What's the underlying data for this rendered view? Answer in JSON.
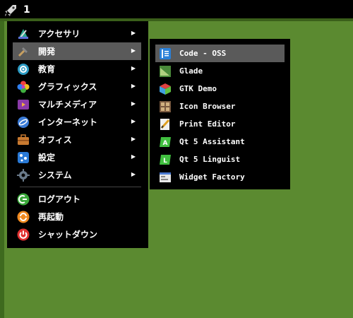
{
  "panel": {
    "workspace_number": "1",
    "launcher_icon": "rocket-icon"
  },
  "menu": {
    "items": [
      {
        "label": "アクセサリ",
        "icon": "accessories-icon",
        "has_submenu": true
      },
      {
        "label": "開発",
        "icon": "development-icon",
        "has_submenu": true,
        "active": true
      },
      {
        "label": "教育",
        "icon": "education-icon",
        "has_submenu": true
      },
      {
        "label": "グラフィックス",
        "icon": "graphics-icon",
        "has_submenu": true
      },
      {
        "label": "マルチメディア",
        "icon": "multimedia-icon",
        "has_submenu": true
      },
      {
        "label": "インターネット",
        "icon": "internet-icon",
        "has_submenu": true
      },
      {
        "label": "オフィス",
        "icon": "office-icon",
        "has_submenu": true
      },
      {
        "label": "設定",
        "icon": "settings-icon",
        "has_submenu": true
      },
      {
        "label": "システム",
        "icon": "system-icon",
        "has_submenu": true
      }
    ],
    "session": [
      {
        "label": "ログアウト",
        "icon": "logout-icon"
      },
      {
        "label": "再起動",
        "icon": "reboot-icon"
      },
      {
        "label": "シャットダウン",
        "icon": "shutdown-icon"
      }
    ],
    "arrow": "▶"
  },
  "submenu": {
    "items": [
      {
        "label": "Code - OSS",
        "icon": "code-oss-icon",
        "active": true
      },
      {
        "label": "Glade",
        "icon": "glade-icon"
      },
      {
        "label": "GTK Demo",
        "icon": "gtk-demo-icon"
      },
      {
        "label": "Icon Browser",
        "icon": "icon-browser-icon"
      },
      {
        "label": "Print Editor",
        "icon": "print-editor-icon"
      },
      {
        "label": "Qt 5 Assistant",
        "icon": "qt-assistant-icon"
      },
      {
        "label": "Qt 5 Linguist",
        "icon": "qt-linguist-icon"
      },
      {
        "label": "Widget Factory",
        "icon": "widget-factory-icon"
      }
    ]
  },
  "colors": {
    "desktop": "#5b8a30",
    "menu_bg": "#000000",
    "highlight": "#5a5a5a"
  }
}
